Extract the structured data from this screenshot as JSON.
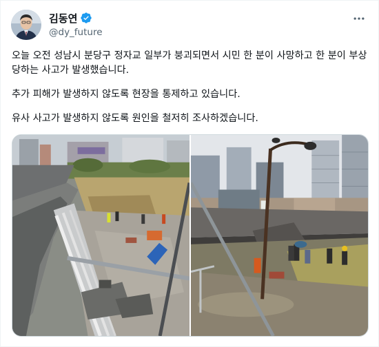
{
  "author": {
    "display_name": "김동연",
    "handle": "@dy_future",
    "avatar_icon": "profile-photo",
    "verified_icon": "verified-badge-icon"
  },
  "more_icon": "more-horizontal-icon",
  "tweet": {
    "paragraphs": [
      "오늘 오전 성남시 분당구 정자교 일부가 붕괴되면서 시민 한 분이 사망하고 한 분이 부상당하는 사고가 발생했습니다.",
      "추가 피해가 발생하지 않도록 현장을 통제하고 있습니다.",
      "유사 사고가 발생하지 않도록 원인을 철저히 조사하겠습니다."
    ]
  },
  "media": {
    "photos": [
      "collapsed-bridge-walkway-photo",
      "bridge-collapse-site-photo"
    ]
  },
  "colors": {
    "verified": "#1d9bf0",
    "text": "#0f1419",
    "secondary": "#536471",
    "border": "#cfd9de"
  }
}
